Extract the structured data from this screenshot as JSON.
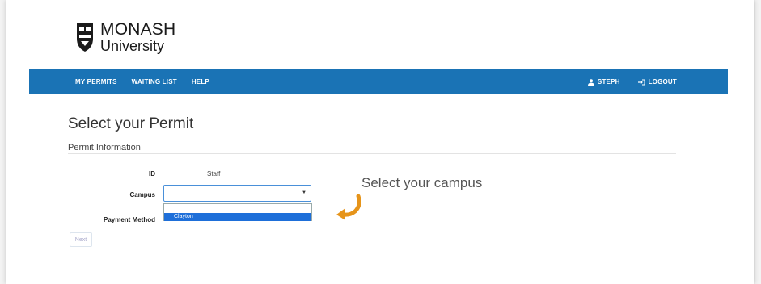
{
  "logo": {
    "line1": "MONASH",
    "line2": "University"
  },
  "nav": {
    "links": [
      "MY PERMITS",
      "WAITING LIST",
      "HELP"
    ],
    "user": "STEPH",
    "logout": "LOGOUT"
  },
  "page": {
    "title": "Select your Permit",
    "section": "Permit Information"
  },
  "form": {
    "id_label": "ID",
    "id_value": "Staff",
    "campus_label": "Campus",
    "campus_value": "",
    "campus_options": [
      "Clayton"
    ],
    "payment_label": "Payment Method",
    "next_label": "Next"
  },
  "annotation": {
    "text": "Select your campus"
  },
  "colors": {
    "navbar": "#1a73b5",
    "selected_option": "#1e6fd9",
    "arrow": "#e6941a"
  }
}
